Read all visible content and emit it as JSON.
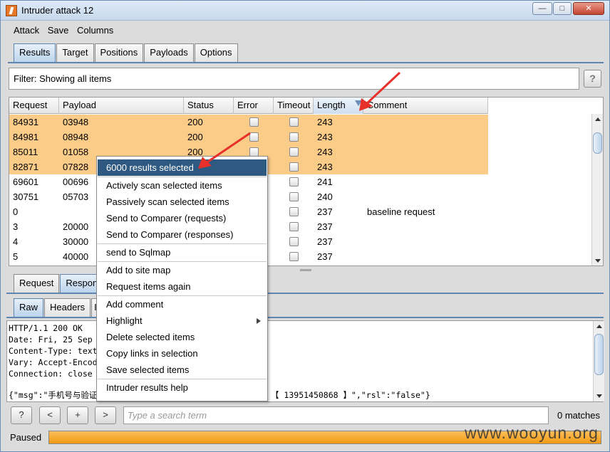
{
  "window": {
    "title": "Intruder attack 12",
    "min_label": "—",
    "max_label": "□",
    "close_label": "✕"
  },
  "menu": [
    "Attack",
    "Save",
    "Columns"
  ],
  "main_tabs": [
    "Results",
    "Target",
    "Positions",
    "Payloads",
    "Options"
  ],
  "filter": {
    "text": "Filter: Showing all items",
    "help_label": "?"
  },
  "table": {
    "columns": [
      "Request",
      "Payload",
      "Status",
      "Error",
      "Timeout",
      "Length",
      "Comment"
    ],
    "sorted_column": "Length",
    "rows": [
      {
        "request": "84931",
        "payload": "03948",
        "status": "200",
        "length": "243",
        "comment": "",
        "selected": true
      },
      {
        "request": "84981",
        "payload": "08948",
        "status": "200",
        "length": "243",
        "comment": "",
        "selected": true
      },
      {
        "request": "85011",
        "payload": "01058",
        "status": "200",
        "length": "243",
        "comment": "",
        "selected": true
      },
      {
        "request": "82871",
        "payload": "07828",
        "status": "",
        "length": "243",
        "comment": "",
        "selected": true
      },
      {
        "request": "69601",
        "payload": "00696",
        "status": "",
        "length": "241",
        "comment": "",
        "selected": false
      },
      {
        "request": "30751",
        "payload": "05703",
        "status": "",
        "length": "240",
        "comment": "",
        "selected": false
      },
      {
        "request": "0",
        "payload": "",
        "status": "",
        "length": "237",
        "comment": "baseline request",
        "selected": false
      },
      {
        "request": "3",
        "payload": "20000",
        "status": "",
        "length": "237",
        "comment": "",
        "selected": false
      },
      {
        "request": "4",
        "payload": "30000",
        "status": "",
        "length": "237",
        "comment": "",
        "selected": false
      },
      {
        "request": "5",
        "payload": "40000",
        "status": "",
        "length": "237",
        "comment": "",
        "selected": false
      }
    ]
  },
  "req_resp_tabs": [
    "Request",
    "Respon"
  ],
  "view_tabs": [
    "Raw",
    "Headers",
    "I"
  ],
  "response_lines": [
    "HTTP/1.1 200 OK",
    "Date: Fri, 25 Sep",
    "Content-Type: text",
    "Vary: Accept-Encod",
    "Connection: close"
  ],
  "response_body_left": "{\"msg\":\"手机号与验证",
  "response_body_right": "【 13951450868 】\",\"rsl\":\"false\"}",
  "context_menu": {
    "header": "6000 results selected",
    "groups": [
      [
        "Actively scan selected items",
        "Passively scan selected items",
        "Send to Comparer (requests)",
        "Send to Comparer (responses)"
      ],
      [
        "send to Sqlmap"
      ],
      [
        "Add to site map",
        "Request items again"
      ],
      [
        "Add comment",
        "Highlight",
        "Delete selected items",
        "Copy links in selection",
        "Save selected items"
      ],
      [
        "Intruder results help"
      ]
    ]
  },
  "search": {
    "help_label": "?",
    "prev_label": "<",
    "add_label": "+",
    "next_label": ">",
    "placeholder": "Type a search term",
    "matches": "0 matches"
  },
  "status": {
    "label": "Paused",
    "progress": 1.0
  },
  "watermark": "www.wooyun.org",
  "colors": {
    "selected_row": "#fbcb88",
    "menu_highlight": "#2e5980",
    "annotation_arrow": "#e8302a",
    "progress": "#f39a12"
  }
}
